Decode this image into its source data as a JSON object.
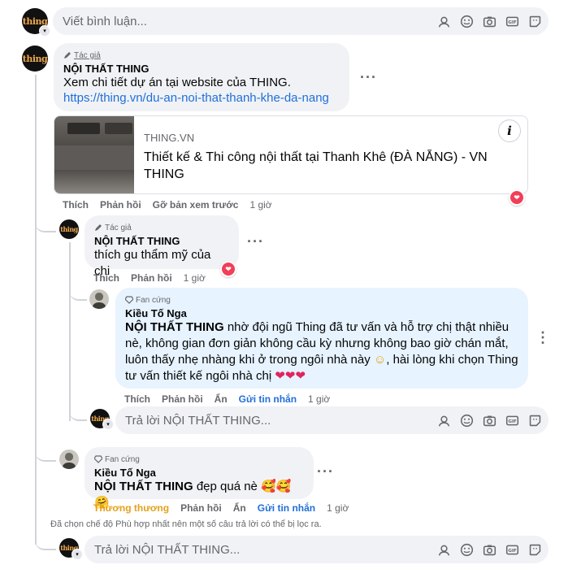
{
  "top_input": {
    "placeholder": "Viết bình luận..."
  },
  "avatar_text": "thing",
  "comment_main": {
    "badge": "Tác giả",
    "name": "NỘI THẤT THING",
    "text": "Xem chi tiết dự án tại website của THING.",
    "link": "https://thing.vn/du-an-noi-that-thanh-khe-da-nang",
    "preview": {
      "domain": "THING.VN",
      "title": "Thiết kế & Thi công nội thất tại Thanh Khê (ĐÀ NẴNG) - VN THING",
      "info_icon": "i"
    },
    "actions": {
      "like": "Thích",
      "reply": "Phản hồi",
      "remove_preview": "Gỡ bản xem trước",
      "time": "1 giờ"
    },
    "reaction": "heart"
  },
  "reply_author": {
    "badge": "Tác giả",
    "name": "NỘI THẤT THING",
    "text": "thích gu thẩm mỹ của chi",
    "actions": {
      "like": "Thích",
      "reply": "Phản hồi",
      "time": "1 giờ"
    },
    "reaction": "heart"
  },
  "reply_fan_1": {
    "badge": "Fan cứng",
    "name": "Kiều Tố Nga",
    "mention": "NỘI THẤT THING",
    "text": " nhờ đội ngũ Thing đã tư vấn và hỗ trợ chị thật nhiều nè, không gian đơn giản không cầu kỳ nhưng không bao giờ chán mắt, luôn thấy nhẹ nhàng khi ở trong ngôi nhà này ",
    "emoji1": "☺",
    "text2": ", hài lòng khi chọn Thing tư vấn thiết kế ngôi nhà chị ",
    "hearts": "❤❤❤",
    "actions": {
      "like": "Thích",
      "reply": "Phản hồi",
      "hide": "Ẩn",
      "message": "Gửi tin nhắn",
      "time": "1 giờ"
    }
  },
  "reply_input_1": {
    "placeholder": "Trả lời NỘI THẤT THING..."
  },
  "reply_fan_2": {
    "badge": "Fan cứng",
    "name": "Kiều Tố Nga",
    "mention": "NỘI THẤT THING",
    "text": " đẹp quá nè ",
    "emojis": "🥰🥰 🤗",
    "actions": {
      "love": "Thương thương",
      "reply": "Phản hồi",
      "hide": "Ẩn",
      "message": "Gửi tin nhắn",
      "time": "1 giờ"
    }
  },
  "filter_note": "Đã chọn chế độ Phù hợp nhất nên một số câu trả lời có thể bị lọc ra.",
  "reply_input_2": {
    "placeholder": "Trả lời NỘI THẤT THING..."
  },
  "colors": {
    "link": "#216fdb",
    "bubble": "#f0f2f5",
    "bubble_blue": "#e7f3ff",
    "heart": "#f33e58",
    "love_text": "#e4a11b"
  }
}
